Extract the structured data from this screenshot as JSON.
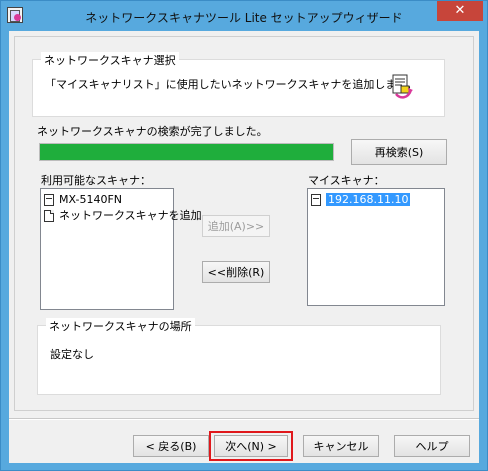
{
  "window": {
    "title": "ネットワークスキャナツール Lite セットアップウィザード",
    "close_glyph": "✕"
  },
  "selection_group": {
    "label": "ネットワークスキャナ選択",
    "description": "「マイスキャナリスト」に使用したいネットワークスキャナを追加します。"
  },
  "search": {
    "status": "ネットワークスキャナの検索が完了しました。",
    "progress_fraction": 1.0,
    "research_button": "再検索(S)"
  },
  "available_scanners": {
    "label": "利用可能なスキャナ：",
    "items": [
      {
        "label": "MX-5140FN",
        "icon": "scanner-icon"
      },
      {
        "label": "ネットワークスキャナを追加",
        "icon": "document-icon"
      }
    ]
  },
  "transfer": {
    "add_button": "追加(A)>>",
    "remove_button": "<<削除(R)"
  },
  "my_scanners": {
    "label": "マイスキャナ：",
    "items": [
      {
        "label": "192.168.11.10",
        "icon": "scanner-icon",
        "selected": true
      }
    ]
  },
  "location_group": {
    "label": "ネットワークスキャナの場所",
    "value": "設定なし"
  },
  "footer": {
    "back_button": "< 戻る(B)",
    "next_button": "次へ(N) >",
    "cancel_button": "キャンセル",
    "help_button": "ヘルプ"
  },
  "colors": {
    "titlebar": "#57a9de",
    "progress": "#1fae3c",
    "close": "#c7453a",
    "highlight": "#e0181c",
    "selection": "#3399ff"
  }
}
